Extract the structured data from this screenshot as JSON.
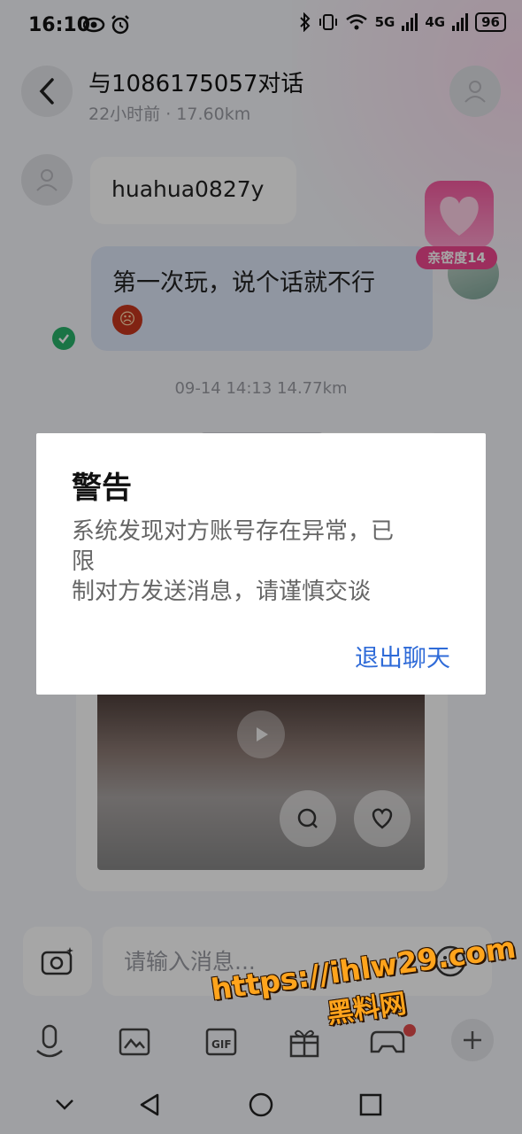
{
  "status_bar": {
    "time": "16:10",
    "battery": "96",
    "signal_5g": "5G",
    "signal_4g": "4G"
  },
  "header": {
    "title": "与1086175057对话",
    "subtitle": "22小时前 · 17.60km"
  },
  "messages": {
    "peer_text": "huahua0827y",
    "my_text": "第一次玩，说个话就不行",
    "timestamp": "09-14 14:13  14.77km"
  },
  "intimacy": {
    "label": "亲密度14"
  },
  "input": {
    "placeholder": "请输入消息..."
  },
  "dialog": {
    "title": "警告",
    "message_line1": "系统发现对方账号存在异常，已",
    "message_line2": "限",
    "message_line3": "制对方发送消息，请谨慎交谈",
    "button_label": "退出聊天"
  },
  "watermark": {
    "url": "https://ihlw29.com",
    "name": "黑料网"
  },
  "colors": {
    "accent": "#2f6bd8",
    "intimacy": "#f0488f",
    "check": "#29b36b"
  }
}
